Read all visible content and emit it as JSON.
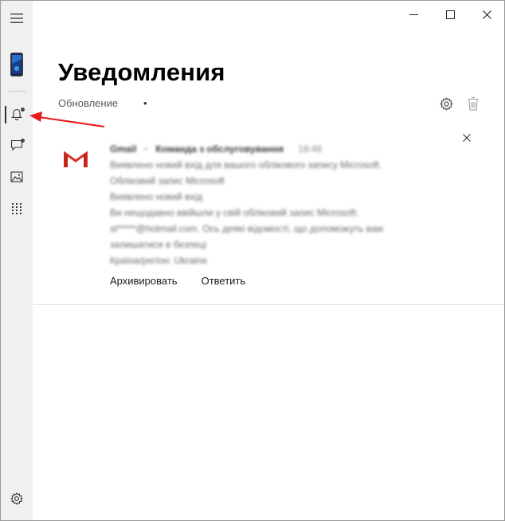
{
  "window": {
    "controls": {
      "minimize": "minimize-icon",
      "maximize": "maximize-icon",
      "close": "close-icon"
    }
  },
  "sidebar": {
    "items": [
      {
        "id": "menu",
        "icon": "hamburger-icon"
      },
      {
        "id": "phone",
        "icon": "phone-icon"
      },
      {
        "id": "notifications",
        "icon": "bell-icon",
        "active": true,
        "badge": true
      },
      {
        "id": "messages",
        "icon": "message-icon",
        "badge": true
      },
      {
        "id": "photos",
        "icon": "photo-icon"
      },
      {
        "id": "apps",
        "icon": "apps-grid-icon"
      },
      {
        "id": "settings",
        "icon": "gear-icon"
      }
    ]
  },
  "page": {
    "title": "Уведомления",
    "status": "Обновление",
    "bullet": "•"
  },
  "notification": {
    "app": "Gmail",
    "separator": "·",
    "sender": "Команда з обслуговування",
    "time": "18:46",
    "body_lines": [
      "Виявлено новий вхід для вашого облікового запису Microsoft.",
      "Обліковий запис Microsoft",
      "Виявлено новий вхід",
      "Ви нещодавно ввійшли у свій обліковий запис Microsoft:",
      "st*****@hotmail.com. Ось деякі відомості, що допоможуть вам",
      "залишатися в безпеці",
      "Країна/регіон: Ukraine"
    ],
    "actions": {
      "archive": "Архивировать",
      "reply": "Ответить"
    }
  },
  "colors": {
    "sidebar_bg": "#f0f0f0",
    "gmail_red": "#d93025",
    "annotation_arrow": "#e8191a"
  }
}
